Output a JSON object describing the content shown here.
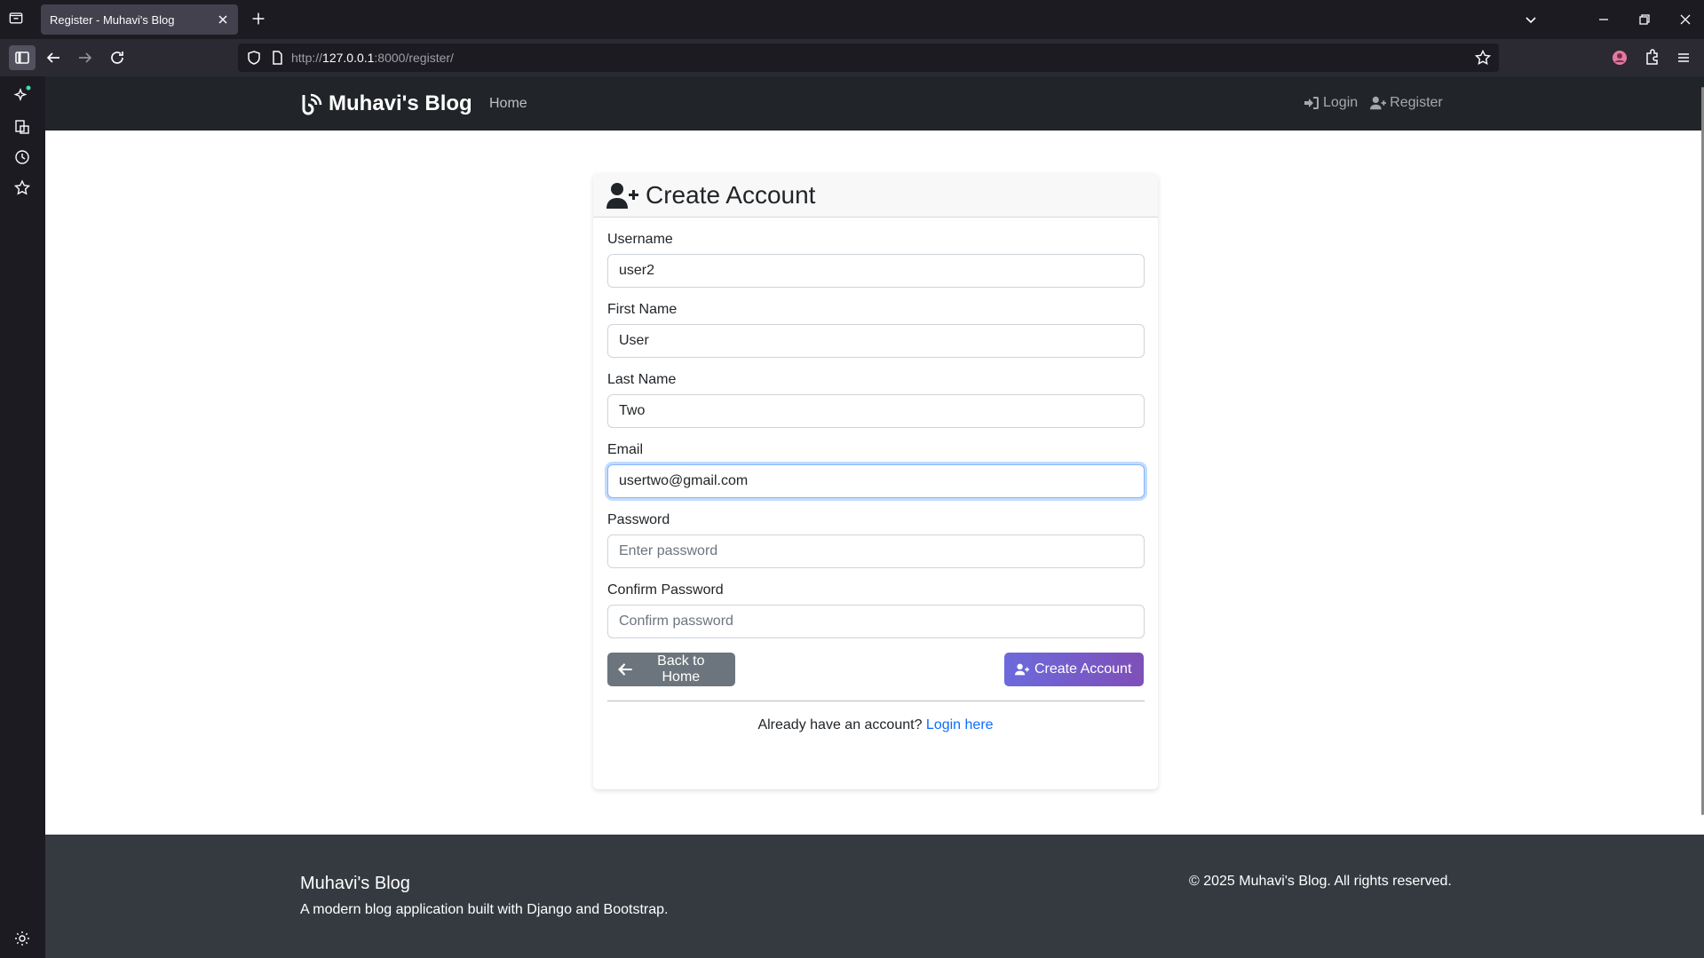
{
  "browser": {
    "tab_title": "Register - Muhavi's Blog",
    "url_prefix": "http://",
    "url_host": "127.0.0.1",
    "url_rest": ":8000/register/"
  },
  "site": {
    "brand": "Muhavi's Blog",
    "nav_home": "Home",
    "nav_login": "Login",
    "nav_register": "Register"
  },
  "form": {
    "title": "Create Account",
    "fields": [
      {
        "label": "Username",
        "value": "user2",
        "placeholder": ""
      },
      {
        "label": "First Name",
        "value": "User",
        "placeholder": ""
      },
      {
        "label": "Last Name",
        "value": "Two",
        "placeholder": ""
      },
      {
        "label": "Email",
        "value": "usertwo@gmail.com",
        "placeholder": ""
      },
      {
        "label": "Password",
        "value": "",
        "placeholder": "Enter password"
      },
      {
        "label": "Confirm Password",
        "value": "",
        "placeholder": "Confirm password"
      }
    ],
    "back_label": "Back to Home",
    "submit_label": "Create Account",
    "login_prompt": "Already have an account?",
    "login_link": "Login here"
  },
  "footer": {
    "title": "Muhavi's Blog",
    "description": "A modern blog application built with Django and Bootstrap.",
    "copyright": "© 2025 Muhavi's Blog. All rights reserved."
  },
  "colors": {
    "accent": "#0d6efd",
    "submit_gradient_start": "#6c6adc",
    "submit_gradient_end": "#7f4fb8",
    "secondary": "#6c757d"
  }
}
